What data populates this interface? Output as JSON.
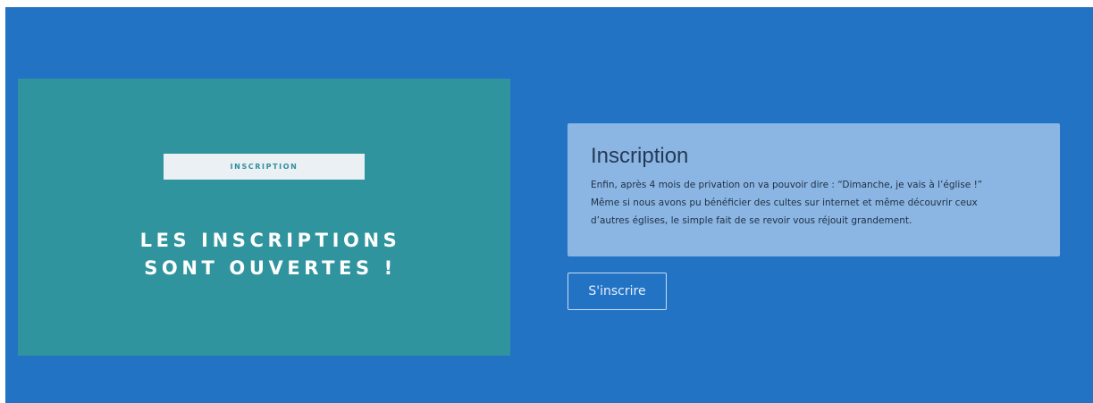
{
  "colors": {
    "page_background": "#2373c5",
    "banner_background": "#30949e",
    "tag_background": "#eaf0f4",
    "card_background": "#8bb6e3"
  },
  "banner": {
    "tag": "INSCRIPTION",
    "headline_line1": "LES INSCRIPTIONS",
    "headline_line2": "SONT OUVERTES !"
  },
  "card": {
    "title": "Inscription",
    "body_lines": [
      "Enfin, après 4 mois de privation on va pouvoir dire : “Dimanche, je vais à l’église !”",
      "Même si nous avons pu bénéficier des cultes sur internet et même découvrir ceux",
      "d’autres églises, le simple fait de se revoir vous réjouit grandement."
    ]
  },
  "cta": {
    "label": "S'inscrire"
  }
}
